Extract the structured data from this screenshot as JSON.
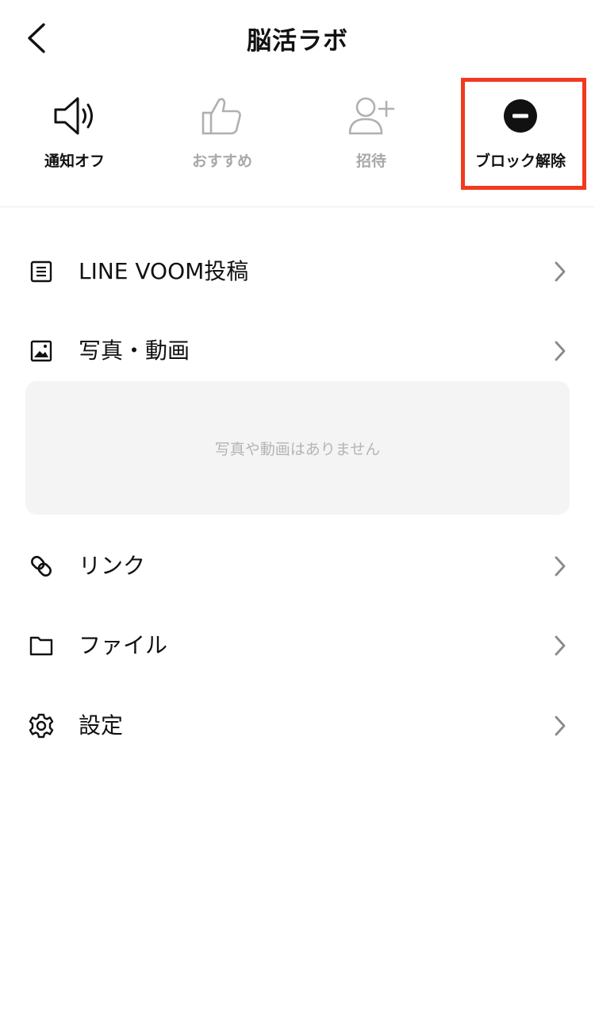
{
  "header": {
    "title": "脳活ラボ",
    "back_icon": "chevron-left-icon"
  },
  "actions": [
    {
      "label": "通知オフ",
      "icon": "speaker-icon",
      "state": "enabled"
    },
    {
      "label": "おすすめ",
      "icon": "thumbs-up-icon",
      "state": "disabled"
    },
    {
      "label": "招待",
      "icon": "add-person-icon",
      "state": "disabled"
    },
    {
      "label": "ブロック解除",
      "icon": "minus-circle-icon",
      "state": "enabled",
      "highlighted": true
    }
  ],
  "menu": [
    {
      "label": "LINE VOOM投稿",
      "icon": "document-icon"
    },
    {
      "label": "写真・動画",
      "icon": "image-icon"
    },
    {
      "label": "リンク",
      "icon": "link-icon"
    },
    {
      "label": "ファイル",
      "icon": "folder-icon"
    },
    {
      "label": "設定",
      "icon": "gear-icon"
    }
  ],
  "media_empty_text": "写真や動画はありません",
  "colors": {
    "highlight_border": "#f03a1e",
    "disabled_text": "#a8a8a8",
    "empty_box_bg": "#f4f4f4"
  }
}
